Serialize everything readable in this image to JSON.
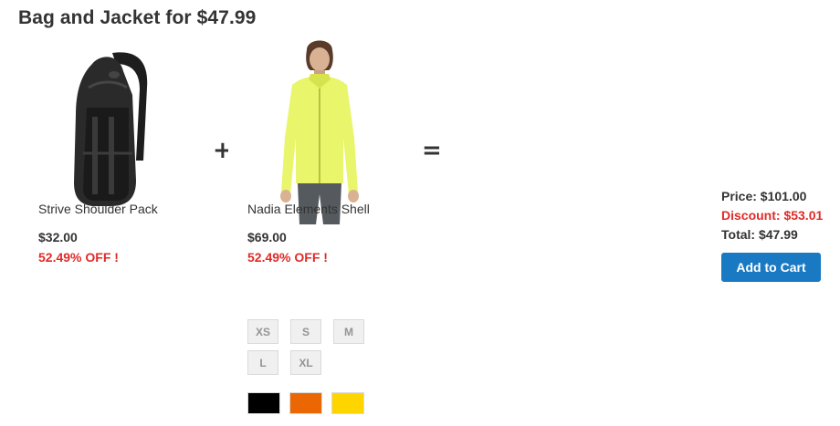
{
  "title": "Bag and Jacket for $47.99",
  "operators": {
    "plus": "+",
    "equals": "="
  },
  "products": [
    {
      "name": "Strive Shoulder Pack",
      "price": "$32.00",
      "discount_label": "52.49% OFF !",
      "image_icon": "backpack-icon"
    },
    {
      "name": "Nadia Elements Shell",
      "price": "$69.00",
      "discount_label": "52.49% OFF !",
      "image_icon": "jacket-icon",
      "sizes": [
        "XS",
        "S",
        "M",
        "L",
        "XL"
      ],
      "colors": [
        {
          "name": "Black",
          "hex": "#000000"
        },
        {
          "name": "Orange",
          "hex": "#eb6703"
        },
        {
          "name": "Yellow",
          "hex": "#ffd500"
        }
      ]
    }
  ],
  "summary": {
    "price": "Price: $101.00",
    "discount": "Discount: $53.01",
    "total": "Total: $47.99"
  },
  "add_to_cart_label": "Add to Cart",
  "colors": {
    "text": "#333333",
    "discount_red": "#e02b27",
    "button_blue": "#1979c3"
  }
}
